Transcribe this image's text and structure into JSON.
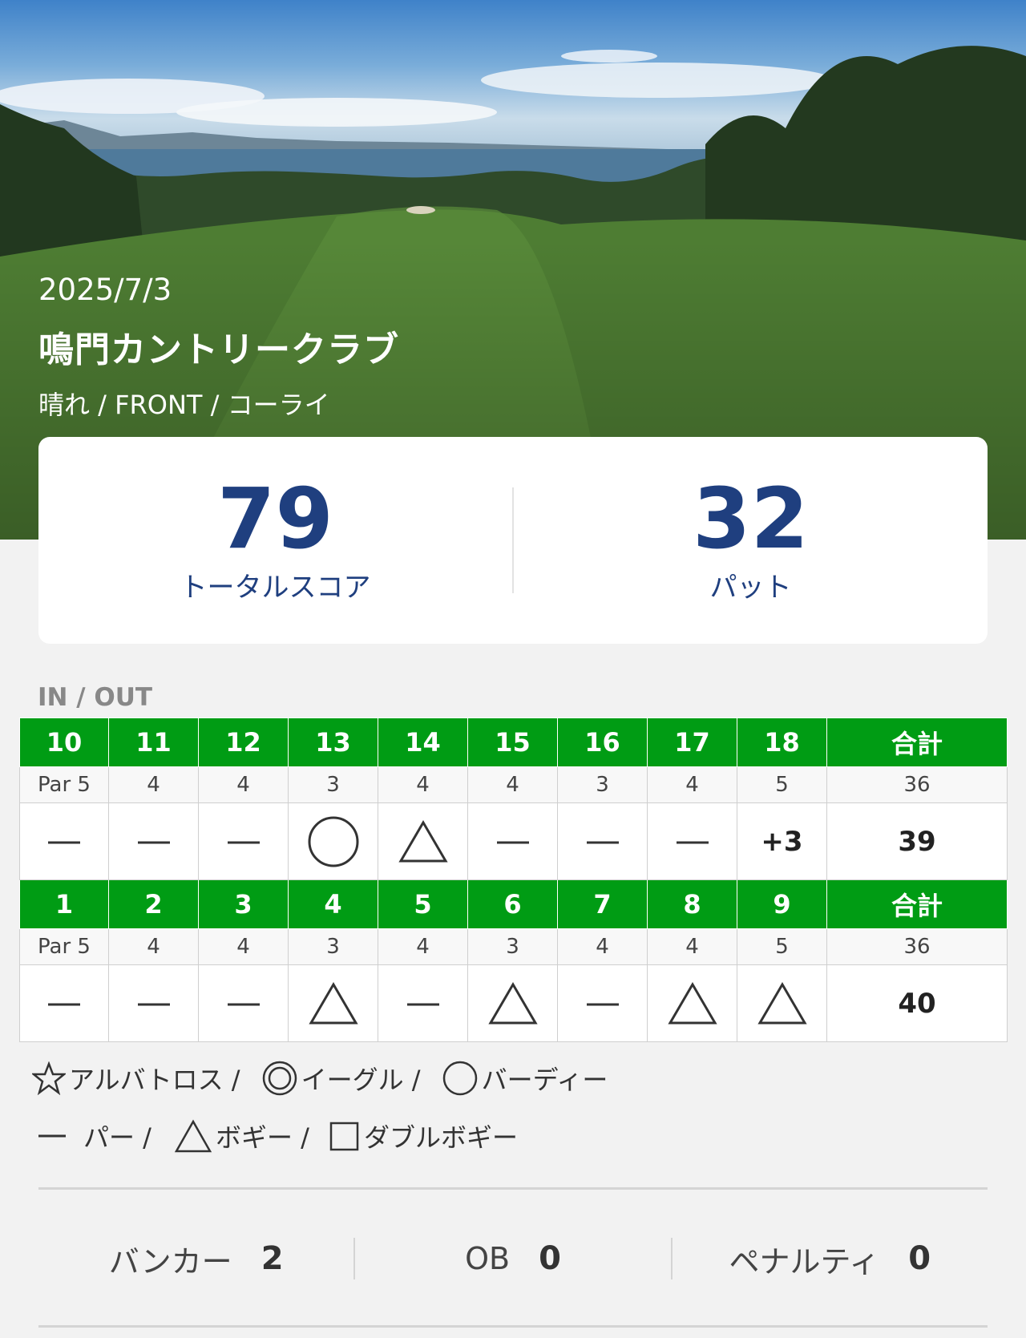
{
  "round": {
    "date": "2025/7/3",
    "course": "鳴門カントリークラブ",
    "meta": "晴れ / FRONT  / コーライ"
  },
  "summary": {
    "total_score": "79",
    "total_label": "トータルスコア",
    "putts": "32",
    "putts_label": "パット"
  },
  "section_label": "IN / OUT",
  "in_half": {
    "holes": [
      "10",
      "11",
      "12",
      "13",
      "14",
      "15",
      "16",
      "17",
      "18"
    ],
    "total_header": "合計",
    "pars": [
      "Par 5",
      "4",
      "4",
      "3",
      "4",
      "4",
      "3",
      "4",
      "5"
    ],
    "par_total": "36",
    "results": [
      "par",
      "par",
      "par",
      "birdie",
      "bogey",
      "par",
      "par",
      "par",
      "+3"
    ],
    "score_total": "39"
  },
  "out_half": {
    "holes": [
      "1",
      "2",
      "3",
      "4",
      "5",
      "6",
      "7",
      "8",
      "9"
    ],
    "total_header": "合計",
    "pars": [
      "Par 5",
      "4",
      "4",
      "3",
      "4",
      "3",
      "4",
      "4",
      "5"
    ],
    "par_total": "36",
    "results": [
      "par",
      "par",
      "par",
      "bogey",
      "par",
      "bogey",
      "par",
      "bogey",
      "bogey"
    ],
    "score_total": "40"
  },
  "legend": {
    "albatross": "アルバトロス /",
    "eagle": "イーグル /",
    "birdie": "バーディー",
    "par": "パー /",
    "bogey": "ボギー /",
    "double_bogey": "ダブルボギー"
  },
  "stats": {
    "bunker_label": "バンカー",
    "bunker_value": "2",
    "ob_label": "OB",
    "ob_value": "0",
    "penalty_label": "ペナルティ",
    "penalty_value": "0"
  },
  "icons": {
    "albatross": "star-outline-icon",
    "eagle": "double-circle-icon",
    "birdie": "circle-icon",
    "par": "dash-icon",
    "bogey": "triangle-icon",
    "double_bogey": "square-icon"
  },
  "colors": {
    "hole_header": "#009c14",
    "score_accent": "#1f3f7f"
  }
}
